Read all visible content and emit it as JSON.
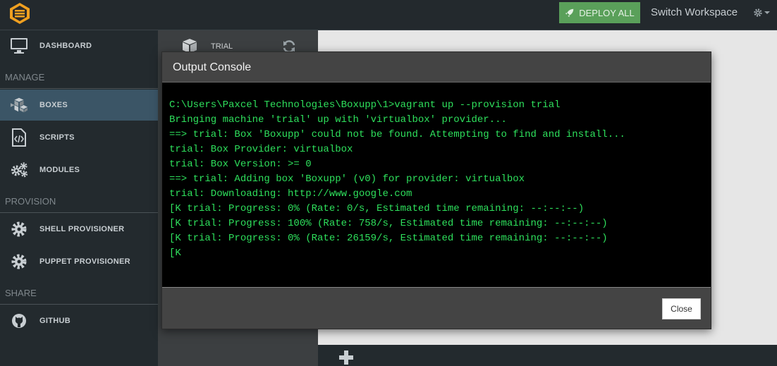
{
  "topbar": {
    "deploy_label": "DEPLOY ALL",
    "switch_workspace_label": "Switch Workspace"
  },
  "sidebar": {
    "items": [
      {
        "label": "DASHBOARD",
        "icon": "monitor-icon"
      },
      {
        "label": "BOXES",
        "icon": "boxes-icon",
        "active": true
      },
      {
        "label": "SCRIPTS",
        "icon": "code-file-icon"
      },
      {
        "label": "MODULES",
        "icon": "gears-icon"
      },
      {
        "label": "SHELL PROVISIONER",
        "icon": "gear-icon"
      },
      {
        "label": "PUPPET PROVISIONER",
        "icon": "gear-icon"
      },
      {
        "label": "GITHUB",
        "icon": "github-icon"
      }
    ],
    "sections": {
      "manage": "MANAGE",
      "provision": "PROVISION",
      "share": "SHARE"
    }
  },
  "box_panel": {
    "box_label": "TRIAL"
  },
  "modal": {
    "title": "Output Console",
    "close_label": "Close",
    "console_lines": [
      "C:\\Users\\Paxcel Technologies\\Boxupp\\1>vagrant up --provision trial",
      "Bringing machine 'trial' up with 'virtualbox' provider...",
      "==> trial: Box 'Boxupp' could not be found. Attempting to find and install...",
      "trial: Box Provider: virtualbox",
      "trial: Box Version: >= 0",
      "==> trial: Adding box 'Boxupp' (v0) for provider: virtualbox",
      "trial: Downloading: http://www.google.com",
      "[K trial: Progress: 0% (Rate: 0/s, Estimated time remaining: --:--:--)",
      "[K trial: Progress: 100% (Rate: 758/s, Estimated time remaining: --:--:--)",
      "[K trial: Progress: 0% (Rate: 26159/s, Estimated time remaining: --:--:--)",
      "[K"
    ]
  },
  "colors": {
    "deploy_green": "#5aa05a",
    "console_text": "#2ee05c",
    "sidebar_bg": "#232a2e",
    "active_item": "#3b5566"
  }
}
